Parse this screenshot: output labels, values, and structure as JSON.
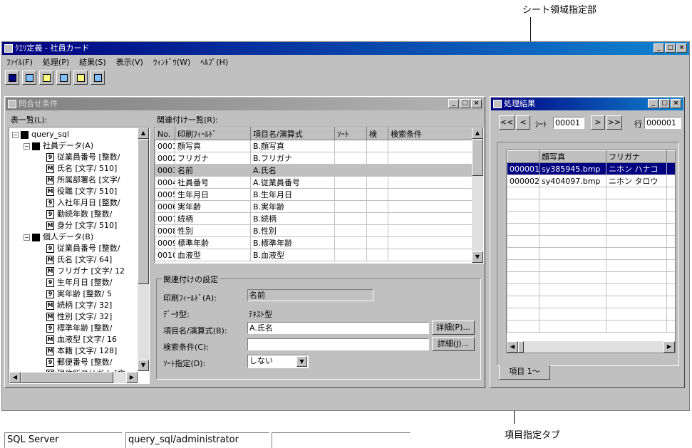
{
  "callouts": {
    "sheet_area": "シート領域指定部",
    "item_tab": "項目指定タブ"
  },
  "app": {
    "title": "ｸｴﾘ定義 - 社員カード",
    "menu": [
      "ﾌｧｲﾙ(F)",
      "処理(P)",
      "結果(S)",
      "表示(V)",
      "ｳｨﾝﾄﾞｳ(W)",
      "ﾍﾙﾌﾟ(H)"
    ]
  },
  "query_panel": {
    "title": "問合せ条件",
    "table_list_label": "表一覧(L):",
    "tree": [
      {
        "level": 0,
        "icon": "db",
        "text": "query_sql"
      },
      {
        "level": 1,
        "icon": "folder",
        "text": "社員データ(A)"
      },
      {
        "level": 2,
        "icon": "9",
        "text": "従業員番号 [整数/"
      },
      {
        "level": 2,
        "icon": "M",
        "text": "氏名 [文字/ 510]"
      },
      {
        "level": 2,
        "icon": "M",
        "text": "所属部署名 [文字/"
      },
      {
        "level": 2,
        "icon": "M",
        "text": "役職 [文字/ 510]"
      },
      {
        "level": 2,
        "icon": "9",
        "text": "入社年月日 [整数/"
      },
      {
        "level": 2,
        "icon": "9",
        "text": "勤続年数 [整数/"
      },
      {
        "level": 2,
        "icon": "M",
        "text": "身分 [文字/ 510]"
      },
      {
        "level": 1,
        "icon": "folder",
        "text": "個人データ(B)"
      },
      {
        "level": 2,
        "icon": "9",
        "text": "従業員番号 [整数/"
      },
      {
        "level": 2,
        "icon": "M",
        "text": "氏名 [文字/ 64]"
      },
      {
        "level": 2,
        "icon": "M",
        "text": "フリガナ [文字/ 12"
      },
      {
        "level": 2,
        "icon": "9",
        "text": "生年月日 [整数/"
      },
      {
        "level": 2,
        "icon": "9",
        "text": "実年齢 [整数/ 5"
      },
      {
        "level": 2,
        "icon": "M",
        "text": "続柄 [文字/ 32]"
      },
      {
        "level": 2,
        "icon": "M",
        "text": "性別 [文字/ 32]"
      },
      {
        "level": 2,
        "icon": "9",
        "text": "標準年齢 [整数/"
      },
      {
        "level": 2,
        "icon": "M",
        "text": "血液型 [文字/ 16"
      },
      {
        "level": 2,
        "icon": "M",
        "text": "本籍 [文字/ 128]"
      },
      {
        "level": 2,
        "icon": "9",
        "text": "郵便番号 [整数/"
      },
      {
        "level": 2,
        "icon": "M",
        "text": "現住所フリガナ [文"
      }
    ],
    "relation_label": "関連付け一覧(R):",
    "relation_headers": [
      "No.",
      "印刷ﾌｨｰﾙﾄﾞ",
      "項目名/演算式",
      "ｿｰﾄ",
      "検",
      "検索条件"
    ],
    "relation_rows": [
      [
        "0001",
        "顔写真",
        "B.顔写真",
        "",
        "",
        ""
      ],
      [
        "0002",
        "フリガナ",
        "B.フリガナ",
        "",
        "",
        ""
      ],
      [
        "0003",
        "名前",
        "A.氏名",
        "",
        "",
        ""
      ],
      [
        "0004",
        "社員番号",
        "A.従業員番号",
        "",
        "",
        ""
      ],
      [
        "0005",
        "生年月日",
        "B.生年月日",
        "",
        "",
        ""
      ],
      [
        "0006",
        "実年齢",
        "B.実年齢",
        "",
        "",
        ""
      ],
      [
        "0007",
        "続柄",
        "B.続柄",
        "",
        "",
        ""
      ],
      [
        "0008",
        "性別",
        "B.性別",
        "",
        "",
        ""
      ],
      [
        "0009",
        "標準年齢",
        "B.標準年齢",
        "",
        "",
        ""
      ],
      [
        "0010",
        "血液型",
        "B.血液型",
        "",
        "",
        ""
      ]
    ],
    "selected_row_index": 2,
    "settings": {
      "group_title": "関連付けの設定",
      "print_field_label": "印刷ﾌｨｰﾙﾄﾞ(A):",
      "print_field_value": "名前",
      "data_type_label": "ﾃﾞｰﾀ型:",
      "data_type_value": "ﾃｷｽﾄ型",
      "item_label": "項目名/演算式(B):",
      "item_value": "A.氏名",
      "detail_p": "詳細(P)...",
      "search_label": "検索条件(C):",
      "search_value": "",
      "detail_j": "詳細(J)...",
      "sort_label": "ｿｰﾄ指定(D):",
      "sort_value": "しない"
    }
  },
  "result_panel": {
    "title": "処理結果",
    "nav_first": "<<",
    "nav_prev": "<",
    "sheet_label": "ｼｰﾄ",
    "sheet_value": "00001",
    "nav_next": ">",
    "nav_last": ">>",
    "row_label": "行",
    "row_value": "000001",
    "headers": [
      "",
      "顔写真",
      "フリガナ",
      ""
    ],
    "rows": [
      [
        "000001",
        "sy385945.bmp",
        "ニホン ハナコ",
        ""
      ],
      [
        "000002",
        "sy404097.bmp",
        "ニホン タロウ",
        ""
      ]
    ],
    "tab_label": "項目 1～"
  },
  "statusbar": [
    "SQL Server",
    "query_sql/administrator",
    ""
  ]
}
